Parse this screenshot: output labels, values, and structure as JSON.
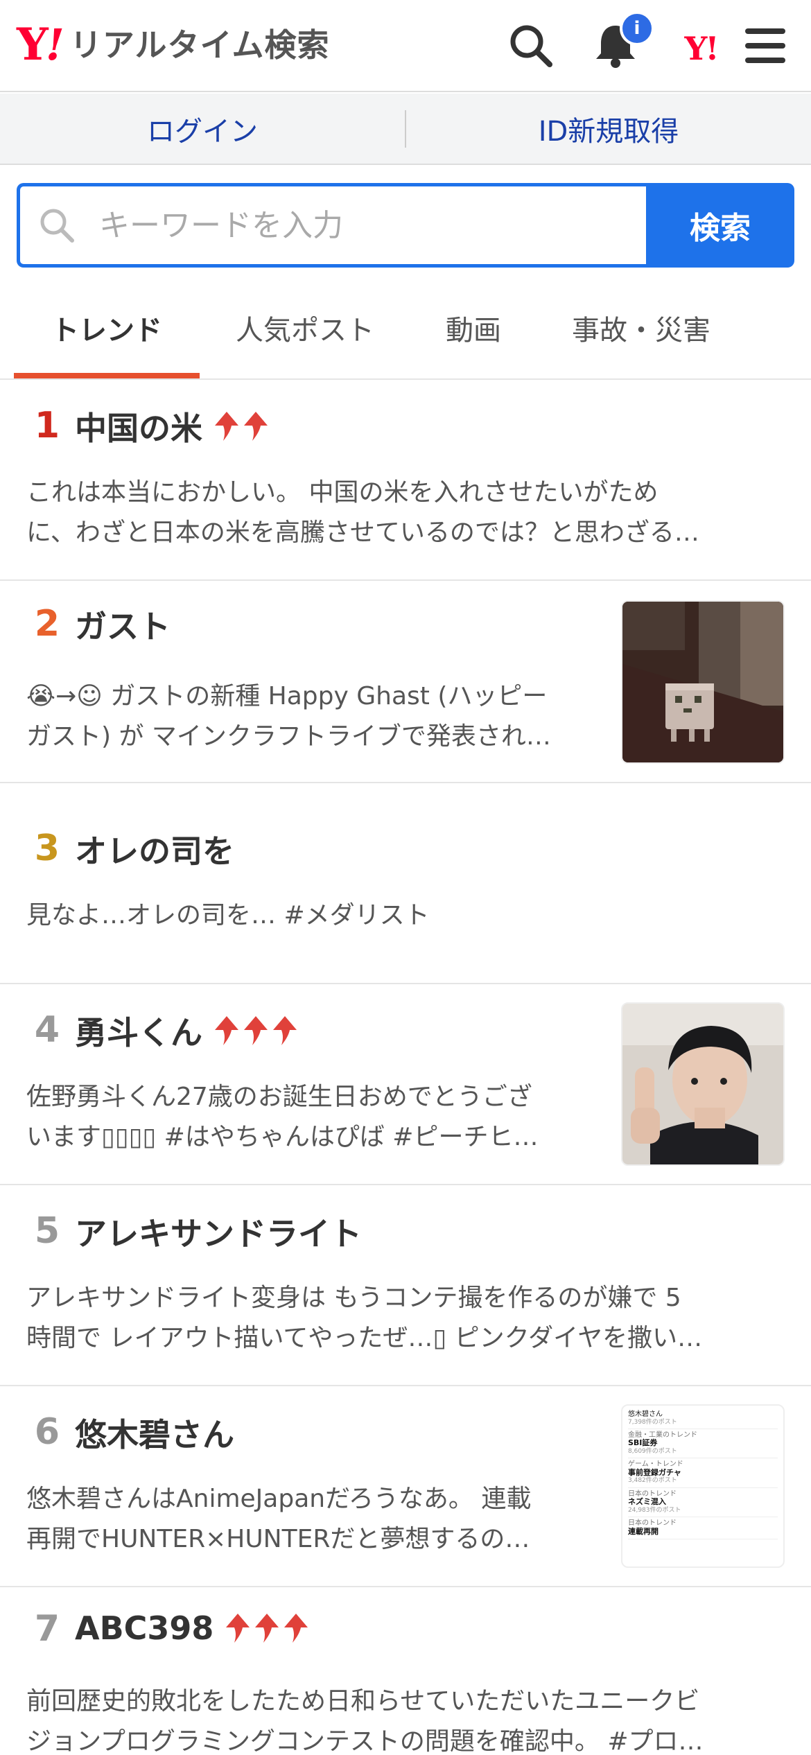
{
  "header": {
    "logo_y": "Y",
    "logo_bang": "!",
    "logo_text": "リアルタイム検索",
    "notification_badge": "i",
    "yahoo_mark": "Y!",
    "icons": [
      "search-icon",
      "bell-icon",
      "yahoo-logo",
      "menu-icon"
    ]
  },
  "login_bar": {
    "login": "ログイン",
    "register": "ID新規取得"
  },
  "search": {
    "placeholder": "キーワードを入力",
    "value": "",
    "button": "検索"
  },
  "tabs": [
    {
      "label": "トレンド",
      "active": true
    },
    {
      "label": "人気ポスト",
      "active": false
    },
    {
      "label": "動画",
      "active": false
    },
    {
      "label": "事故・災害",
      "active": false
    }
  ],
  "colors": {
    "brand_red": "#ff0033",
    "search_blue": "#1e72ea",
    "tab_underline": "#e6502e",
    "rank_1": "#d0291e",
    "rank_2": "#e8612c",
    "rank_3": "#c8961e",
    "rank_other": "#999999",
    "arrow": "#e0413a"
  },
  "trends": [
    {
      "rank": "1",
      "title": "中国の米",
      "arrows": 2,
      "thumb": null,
      "line1": "これは本当におかしい。 中国の米を入れさせたいがため",
      "line2": "に、わざと日本の米を高騰させているのでは？と思わざる…"
    },
    {
      "rank": "2",
      "title": "ガスト",
      "arrows": 0,
      "thumb": "minecraft-ghast-thumbnail",
      "line1": "😭→☺ ガストの新種 Happy Ghast (ハッピー",
      "line2": "ガスト) が マインクラフトライブで発表され…"
    },
    {
      "rank": "3",
      "title": "オレの司を",
      "arrows": 0,
      "thumb": null,
      "line1": "見なよ…オレの司を… #メダリスト",
      "line2": ""
    },
    {
      "rank": "4",
      "title": "勇斗くん",
      "arrows": 3,
      "thumb": "person-photo-thumbnail",
      "line1": "佐野勇斗くん27歳のお誕生日おめでとうござ",
      "line2": "います▯▯▯▯ #はやちゃんはぴば #ピーチヒ…"
    },
    {
      "rank": "5",
      "title": "アレキサンドライト",
      "arrows": 0,
      "thumb": null,
      "line1": "アレキサンドライト変身は もうコンテ撮を作るのが嫌で 5",
      "line2": "時間で レイアウト描いてやったぜ…▯ ピンクダイヤを撒い…"
    },
    {
      "rank": "6",
      "title": "悠木碧さん",
      "arrows": 0,
      "thumb": "trend-list-screenshot-thumbnail",
      "line1": "悠木碧さんはAnimeJapanだろうなあ。 連載",
      "line2": "再開でHUNTER×HUNTERだと夢想するの…"
    },
    {
      "rank": "7",
      "title": "ABC398",
      "arrows": 3,
      "thumb": null,
      "line1": "前回歴史的敗北をしたため日和らせていただいたユニークビ",
      "line2": "ジョンプログラミングコンテストの問題を確認中。 #プロ…"
    }
  ],
  "thumb6": {
    "rows": [
      {
        "cat": "悠木碧さん",
        "name": "",
        "count": "7,398件のポスト"
      },
      {
        "cat": "金融・工業のトレンド",
        "name": "SBI証券",
        "count": "8,609件のポスト"
      },
      {
        "cat": "ゲーム・トレンド",
        "name": "事前登録ガチャ",
        "count": "3,482件のポスト"
      },
      {
        "cat": "日本のトレンド",
        "name": "ネズミ混入",
        "count": "24,983件のポスト"
      },
      {
        "cat": "日本のトレンド",
        "name": "連載再開",
        "count": ""
      }
    ]
  }
}
